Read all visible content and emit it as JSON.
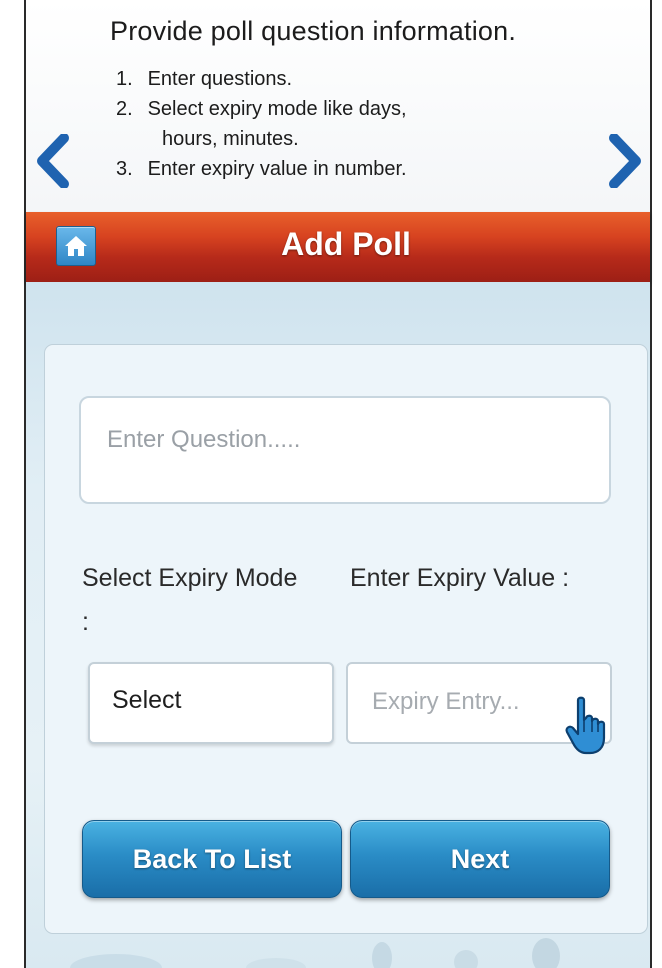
{
  "instructions": {
    "title": "Provide poll question information.",
    "steps": [
      {
        "num": "1.",
        "text": "Enter questions."
      },
      {
        "num": "2.",
        "text": "Select expiry mode like days,",
        "cont": "hours, minutes."
      },
      {
        "num": "3.",
        "text": "Enter expiry value in number."
      }
    ]
  },
  "nav": {
    "prev_icon": "chevron-left-icon",
    "next_icon": "chevron-right-icon"
  },
  "header": {
    "title": "Add Poll",
    "home_icon": "home-icon"
  },
  "form": {
    "question_placeholder": "Enter Question.....",
    "expiry_mode_label": "Select Expiry Mode :",
    "expiry_value_label": "Enter Expiry Value :",
    "expiry_mode_selected": "Select",
    "expiry_value_placeholder": "Expiry Entry...",
    "cursor_icon": "hand-pointer-icon"
  },
  "buttons": {
    "back_label": "Back To List",
    "next_label": "Next"
  },
  "colors": {
    "header_top": "#e8602b",
    "header_bottom": "#9d1f15",
    "button_blue": "#2a8cc6",
    "arrow_blue": "#1f63b0"
  }
}
